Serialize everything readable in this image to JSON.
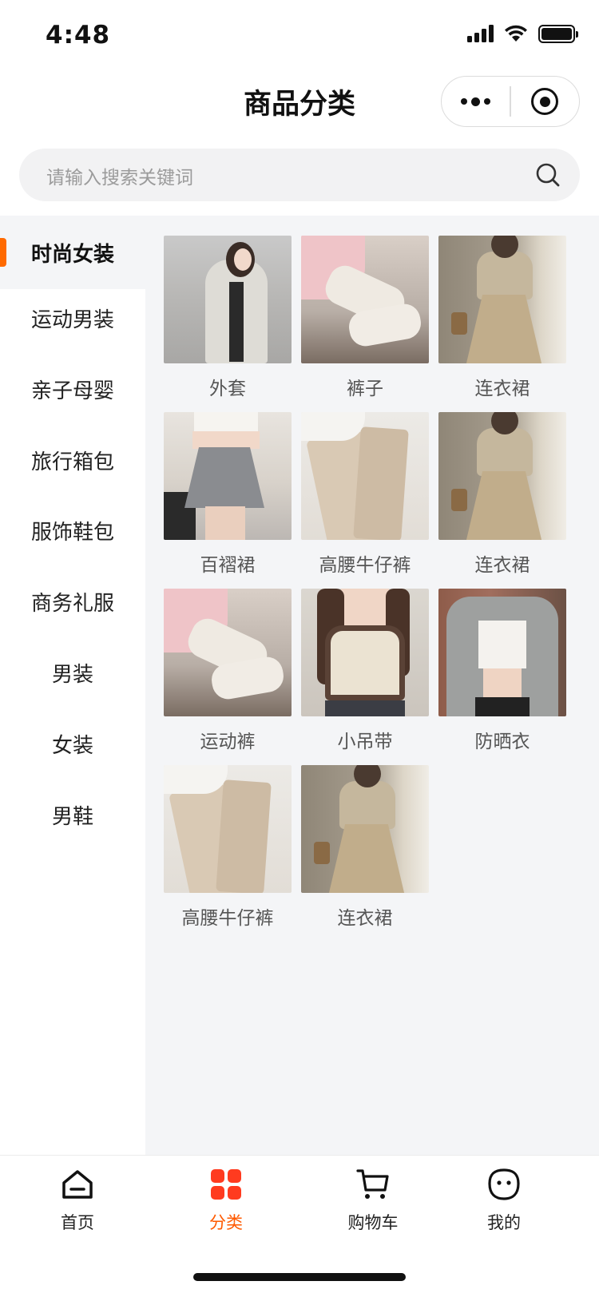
{
  "status_bar": {
    "time": "4:48"
  },
  "nav": {
    "title": "商品分类"
  },
  "search": {
    "placeholder": "请输入搜索关键词"
  },
  "sidebar": {
    "items": [
      {
        "label": "时尚女装"
      },
      {
        "label": "运动男装"
      },
      {
        "label": "亲子母婴"
      },
      {
        "label": "旅行箱包"
      },
      {
        "label": "服饰鞋包"
      },
      {
        "label": "商务礼服"
      },
      {
        "label": "男装"
      },
      {
        "label": "女装"
      },
      {
        "label": "男鞋"
      }
    ],
    "active_index": 0
  },
  "products": [
    {
      "label": "外套",
      "image": "coat"
    },
    {
      "label": "裤子",
      "image": "pants"
    },
    {
      "label": "连衣裙",
      "image": "dress"
    },
    {
      "label": "百褶裙",
      "image": "skirt"
    },
    {
      "label": "高腰牛仔裤",
      "image": "jeans"
    },
    {
      "label": "连衣裙",
      "image": "dress"
    },
    {
      "label": "运动裤",
      "image": "pants"
    },
    {
      "label": "小吊带",
      "image": "tank"
    },
    {
      "label": "防晒衣",
      "image": "sun"
    },
    {
      "label": "高腰牛仔裤",
      "image": "jeans"
    },
    {
      "label": "连衣裙",
      "image": "dress"
    }
  ],
  "tab_bar": {
    "items": [
      {
        "label": "首页",
        "icon": "home-icon"
      },
      {
        "label": "分类",
        "icon": "category-icon"
      },
      {
        "label": "购物车",
        "icon": "cart-icon"
      },
      {
        "label": "我的",
        "icon": "profile-icon"
      }
    ],
    "active_index": 1
  },
  "colors": {
    "accent": "#ff5a00",
    "active_bar": "#ff6a00",
    "category_icon": "#ff3b1f",
    "background": "#f4f5f7"
  }
}
